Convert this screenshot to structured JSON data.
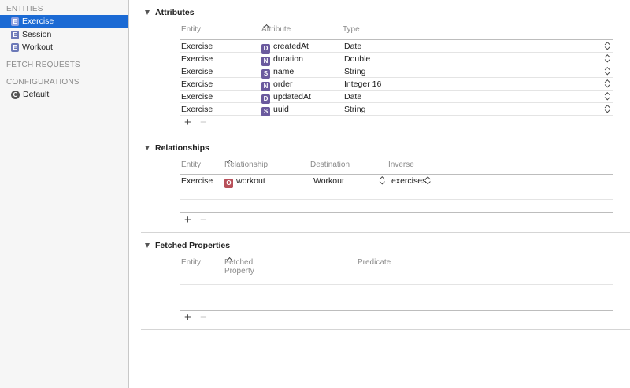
{
  "sidebar": {
    "entities_header": "ENTITIES",
    "entities": [
      {
        "badge": "E",
        "label": "Exercise",
        "selected": true
      },
      {
        "badge": "E",
        "label": "Session",
        "selected": false
      },
      {
        "badge": "E",
        "label": "Workout",
        "selected": false
      }
    ],
    "fetch_requests_header": "FETCH REQUESTS",
    "configurations_header": "CONFIGURATIONS",
    "configurations": [
      {
        "badge": "C",
        "label": "Default"
      }
    ]
  },
  "attributes": {
    "title": "Attributes",
    "columns": {
      "entity": "Entity",
      "attribute": "Attribute",
      "type": "Type"
    },
    "rows": [
      {
        "entity": "Exercise",
        "badge": "D",
        "badge_color": "#6b5a9e",
        "name": "createdAt",
        "type": "Date"
      },
      {
        "entity": "Exercise",
        "badge": "N",
        "badge_color": "#6b5a9e",
        "name": "duration",
        "type": "Double"
      },
      {
        "entity": "Exercise",
        "badge": "S",
        "badge_color": "#6b5a9e",
        "name": "name",
        "type": "String"
      },
      {
        "entity": "Exercise",
        "badge": "N",
        "badge_color": "#6b5a9e",
        "name": "order",
        "type": "Integer 16"
      },
      {
        "entity": "Exercise",
        "badge": "D",
        "badge_color": "#6b5a9e",
        "name": "updatedAt",
        "type": "Date"
      },
      {
        "entity": "Exercise",
        "badge": "S",
        "badge_color": "#6b5a9e",
        "name": "uuid",
        "type": "String"
      }
    ],
    "add_label": "+",
    "remove_label": "−"
  },
  "relationships": {
    "title": "Relationships",
    "columns": {
      "entity": "Entity",
      "relationship": "Relationship",
      "destination": "Destination",
      "inverse": "Inverse"
    },
    "rows": [
      {
        "entity": "Exercise",
        "badge": "O",
        "badge_color": "#b8505a",
        "name": "workout",
        "destination": "Workout",
        "inverse": "exercises"
      }
    ],
    "add_label": "+",
    "remove_label": "−"
  },
  "fetched_properties": {
    "title": "Fetched Properties",
    "columns": {
      "entity": "Entity",
      "fetched_property": "Fetched Property",
      "predicate": "Predicate"
    },
    "add_label": "+",
    "remove_label": "−"
  },
  "colors": {
    "selection": "#1b6ad4",
    "entity_badge": "#6c79b8",
    "attribute_badge": "#6b5a9e",
    "relationship_badge": "#b8505a"
  }
}
